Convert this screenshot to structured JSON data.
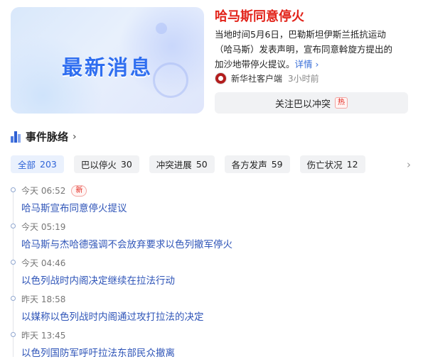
{
  "banner": {
    "text": "最新消息"
  },
  "news": {
    "title": "哈马斯同意停火",
    "desc_lines": [
      "当地时间5月6日，巴勒斯坦伊斯兰抵抗运动",
      "（哈马斯）发表声明，宣布同意斡旋方提出的",
      "加沙地带停火提议。"
    ],
    "more": "详情",
    "more_arrow": "›",
    "source": "新华社客户端",
    "time": "3小时前"
  },
  "follow": {
    "label": "关注巴以冲突",
    "badge": "热"
  },
  "section": {
    "title": "事件脉络",
    "chevron": "›"
  },
  "tabs": [
    {
      "label": "全部",
      "count": "203"
    },
    {
      "label": "巴以停火",
      "count": "30"
    },
    {
      "label": "冲突进展",
      "count": "50"
    },
    {
      "label": "各方发声",
      "count": "59"
    },
    {
      "label": "伤亡状况",
      "count": "12"
    }
  ],
  "tabs_next_icon": "›",
  "timeline": [
    {
      "time": "今天 06:52",
      "badge": "新",
      "title": "哈马斯宣布同意停火提议"
    },
    {
      "time": "今天 05:19",
      "title": "哈马斯与杰哈德强调不会放弃要求以色列撤军停火"
    },
    {
      "time": "今天 04:46",
      "title": "以色列战时内阁决定继续在拉法行动"
    },
    {
      "time": "昨天 18:58",
      "title": "以媒称以色列战时内阁通过攻打拉法的决定"
    },
    {
      "time": "昨天 13:45",
      "title": "以色列国防军呼吁拉法东部民众撤离"
    }
  ],
  "colors": {
    "title_red": "#e2231a",
    "link_blue": "#2f55b8",
    "accent_blue": "#2f64d8"
  }
}
